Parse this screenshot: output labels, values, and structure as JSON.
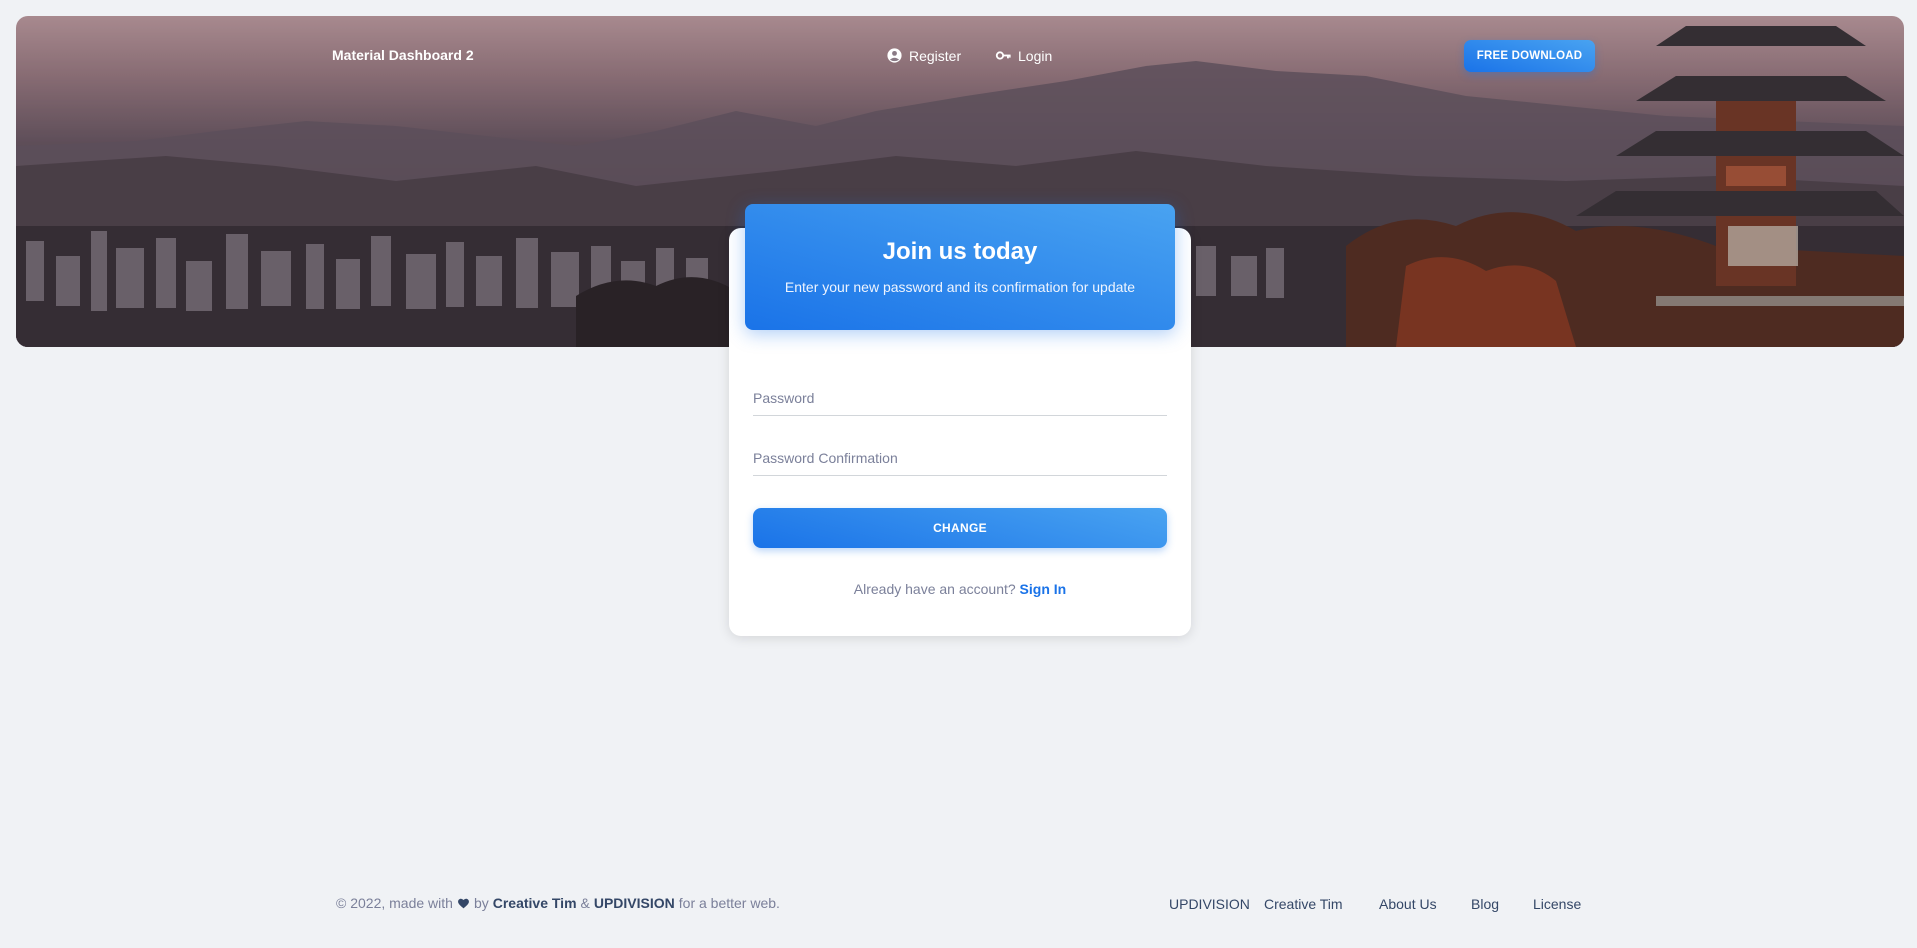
{
  "navbar": {
    "brand": "Material Dashboard 2",
    "links": [
      {
        "label": "Register",
        "icon": "account-circle-icon"
      },
      {
        "label": "Login",
        "icon": "key-icon"
      }
    ],
    "cta_label": "Free Download"
  },
  "card": {
    "title": "Join us today",
    "subtitle": "Enter your new password and its confirmation for update",
    "password_placeholder": "Password",
    "confirm_placeholder": "Password Confirmation",
    "submit_label": "Change",
    "signin_prompt": "Already have an account?",
    "signin_link": "Sign In"
  },
  "footer": {
    "copyright_prefix": "© 2022, made with",
    "by": "by",
    "author1": "Creative Tim",
    "amp": "&",
    "author2": "UPDIVISION",
    "suffix": "for a better web.",
    "links": [
      "UPDIVISION",
      "Creative Tim",
      "About Us",
      "Blog",
      "License"
    ]
  },
  "colors": {
    "primary": "#1a73e8",
    "primary_light": "#49a3f1",
    "background": "#f0f2f5",
    "text_dark": "#344767",
    "text_muted": "#7b809a"
  }
}
